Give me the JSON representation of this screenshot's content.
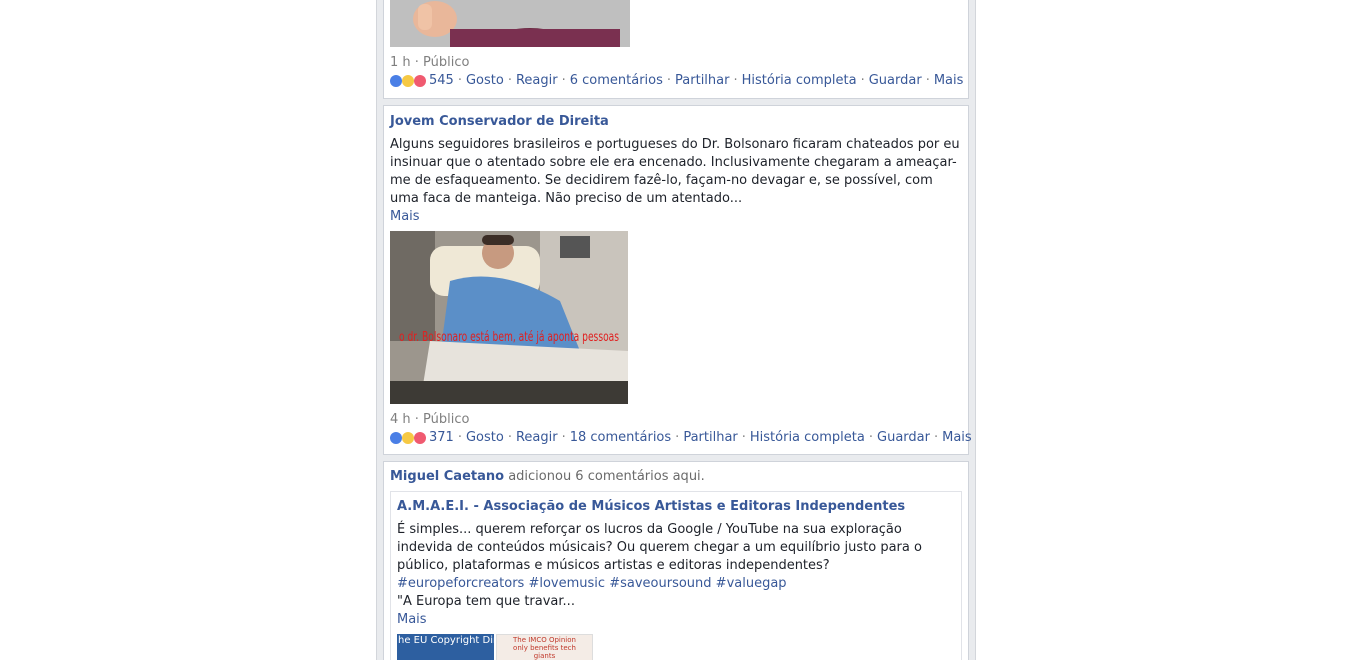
{
  "post1": {
    "time": "1 h · Público",
    "reaction_count": "545",
    "actions": {
      "like": "Gosto",
      "react": "Reagir",
      "comments": "6 comentários",
      "share": "Partilhar",
      "story": "História completa",
      "save": "Guardar",
      "more": "Mais"
    }
  },
  "post2": {
    "author": "Jovem Conservador de Direita",
    "text": "Alguns seguidores brasileiros e portugueses do Dr. Bolsonaro ficaram chateados por eu insinuar que o atentado sobre ele era encenado. Inclusivamente chegaram a ameaçar-me de esfaqueamento. Se decidirem fazê-lo, façam-no devagar e, se possível, com uma faca de manteiga. Não preciso de um atentado...",
    "more": "Mais",
    "image_caption": "o dr. Bolsonaro está bem, até já aponta pessoas",
    "time": "4 h · Público",
    "reaction_count": "371",
    "actions": {
      "like": "Gosto",
      "react": "Reagir",
      "comments": "18 comentários",
      "share": "Partilhar",
      "story": "História completa",
      "save": "Guardar",
      "more": "Mais"
    }
  },
  "post3": {
    "actor": "Miguel Caetano",
    "activity": "adicionou 6 comentários aqui.",
    "shared": {
      "page": "A.M.A.E.I. - Associação de Músicos Artistas e Editoras Independentes",
      "text": "É simples... querem reforçar os lucros da Google / YouTube na sua exploração indevida de conteúdos músicais? Ou querem chegar a um equilíbrio justo para o público, plataformas e músicos artistas e editoras independentes?",
      "hashtags": [
        "#europeforcreators",
        "#lovemusic",
        "#saveoursound",
        "#valuegap"
      ],
      "quote": "\"A Europa tem que travar...",
      "more": "Mais",
      "thumb1_text": "he EU Copyright Directi",
      "thumb2_text": "The IMCO Opinion only benefits tech giants"
    }
  },
  "colors": {
    "link": "#385898",
    "meta": "#7f7f7f",
    "like": "#4a7fe6",
    "haha": "#f6c944",
    "love": "#f05a70"
  }
}
